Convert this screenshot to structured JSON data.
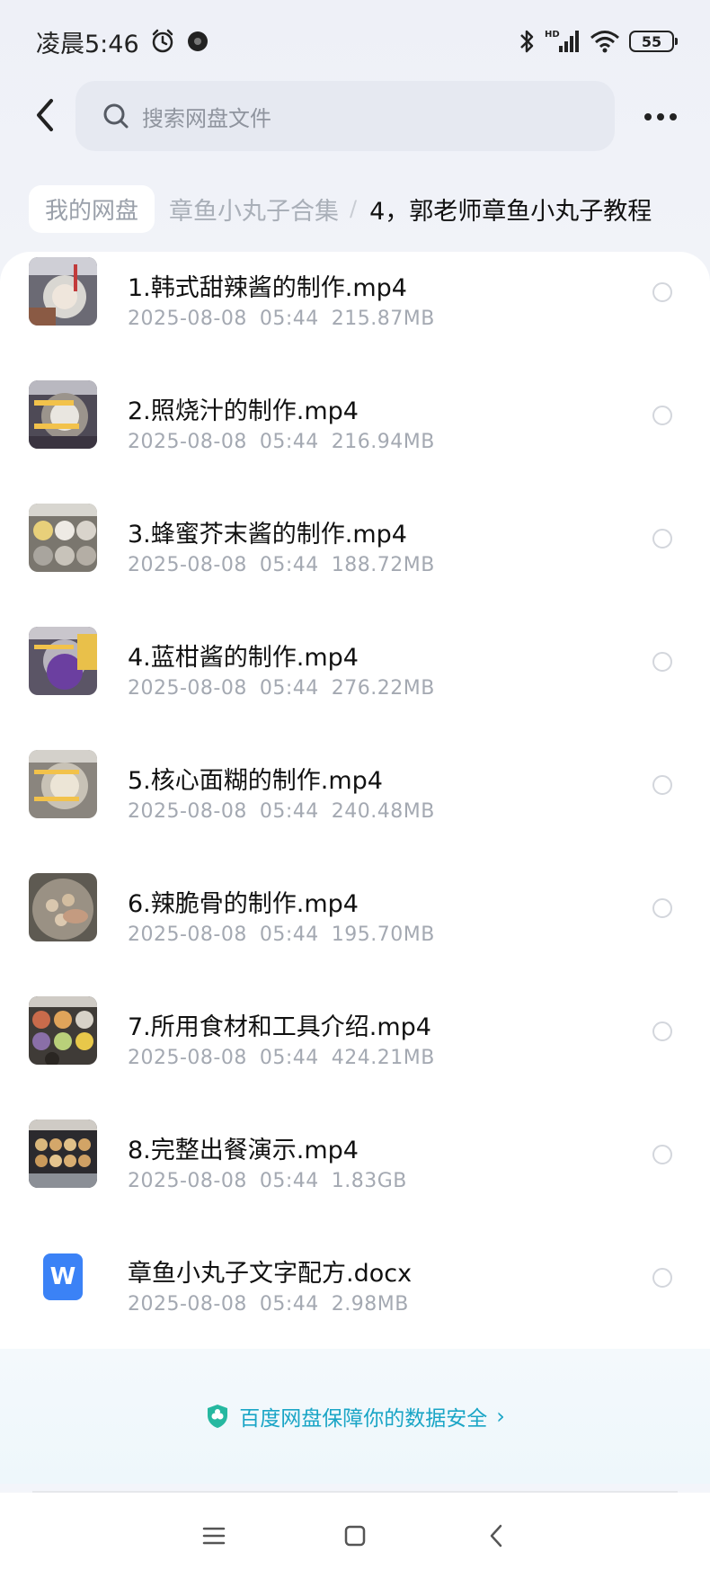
{
  "status_bar": {
    "time": "凌晨5:46",
    "battery": "55",
    "network_label": "HD"
  },
  "header": {
    "search_placeholder": "搜索网盘文件"
  },
  "breadcrumb": {
    "root": "我的网盘",
    "parent": "章鱼小丸子合集",
    "separator": "/",
    "current": "4，郭老师章鱼小丸子教程"
  },
  "files": [
    {
      "name": "1.韩式甜辣酱的制作.mp4",
      "date": "2025-08-08",
      "time": "05:44",
      "size": "215.87MB",
      "type": "video"
    },
    {
      "name": "2.照烧汁的制作.mp4",
      "date": "2025-08-08",
      "time": "05:44",
      "size": "216.94MB",
      "type": "video"
    },
    {
      "name": "3.蜂蜜芥末酱的制作.mp4",
      "date": "2025-08-08",
      "time": "05:44",
      "size": "188.72MB",
      "type": "video"
    },
    {
      "name": "4.蓝柑酱的制作.mp4",
      "date": "2025-08-08",
      "time": "05:44",
      "size": "276.22MB",
      "type": "video"
    },
    {
      "name": "5.核心面糊的制作.mp4",
      "date": "2025-08-08",
      "time": "05:44",
      "size": "240.48MB",
      "type": "video"
    },
    {
      "name": "6.辣脆骨的制作.mp4",
      "date": "2025-08-08",
      "time": "05:44",
      "size": "195.70MB",
      "type": "video"
    },
    {
      "name": "7.所用食材和工具介绍.mp4",
      "date": "2025-08-08",
      "time": "05:44",
      "size": "424.21MB",
      "type": "video"
    },
    {
      "name": "8.完整出餐演示.mp4",
      "date": "2025-08-08",
      "time": "05:44",
      "size": "1.83GB",
      "type": "video"
    },
    {
      "name": "章鱼小丸子文字配方.docx",
      "date": "2025-08-08",
      "time": "05:44",
      "size": "2.98MB",
      "type": "doc"
    }
  ],
  "doc_icon_letter": "W",
  "security": {
    "text": "百度网盘保障你的数据安全",
    "arrow": "›"
  },
  "colors": {
    "accent": "#1aa5c6",
    "doc_icon": "#3b82f6"
  }
}
